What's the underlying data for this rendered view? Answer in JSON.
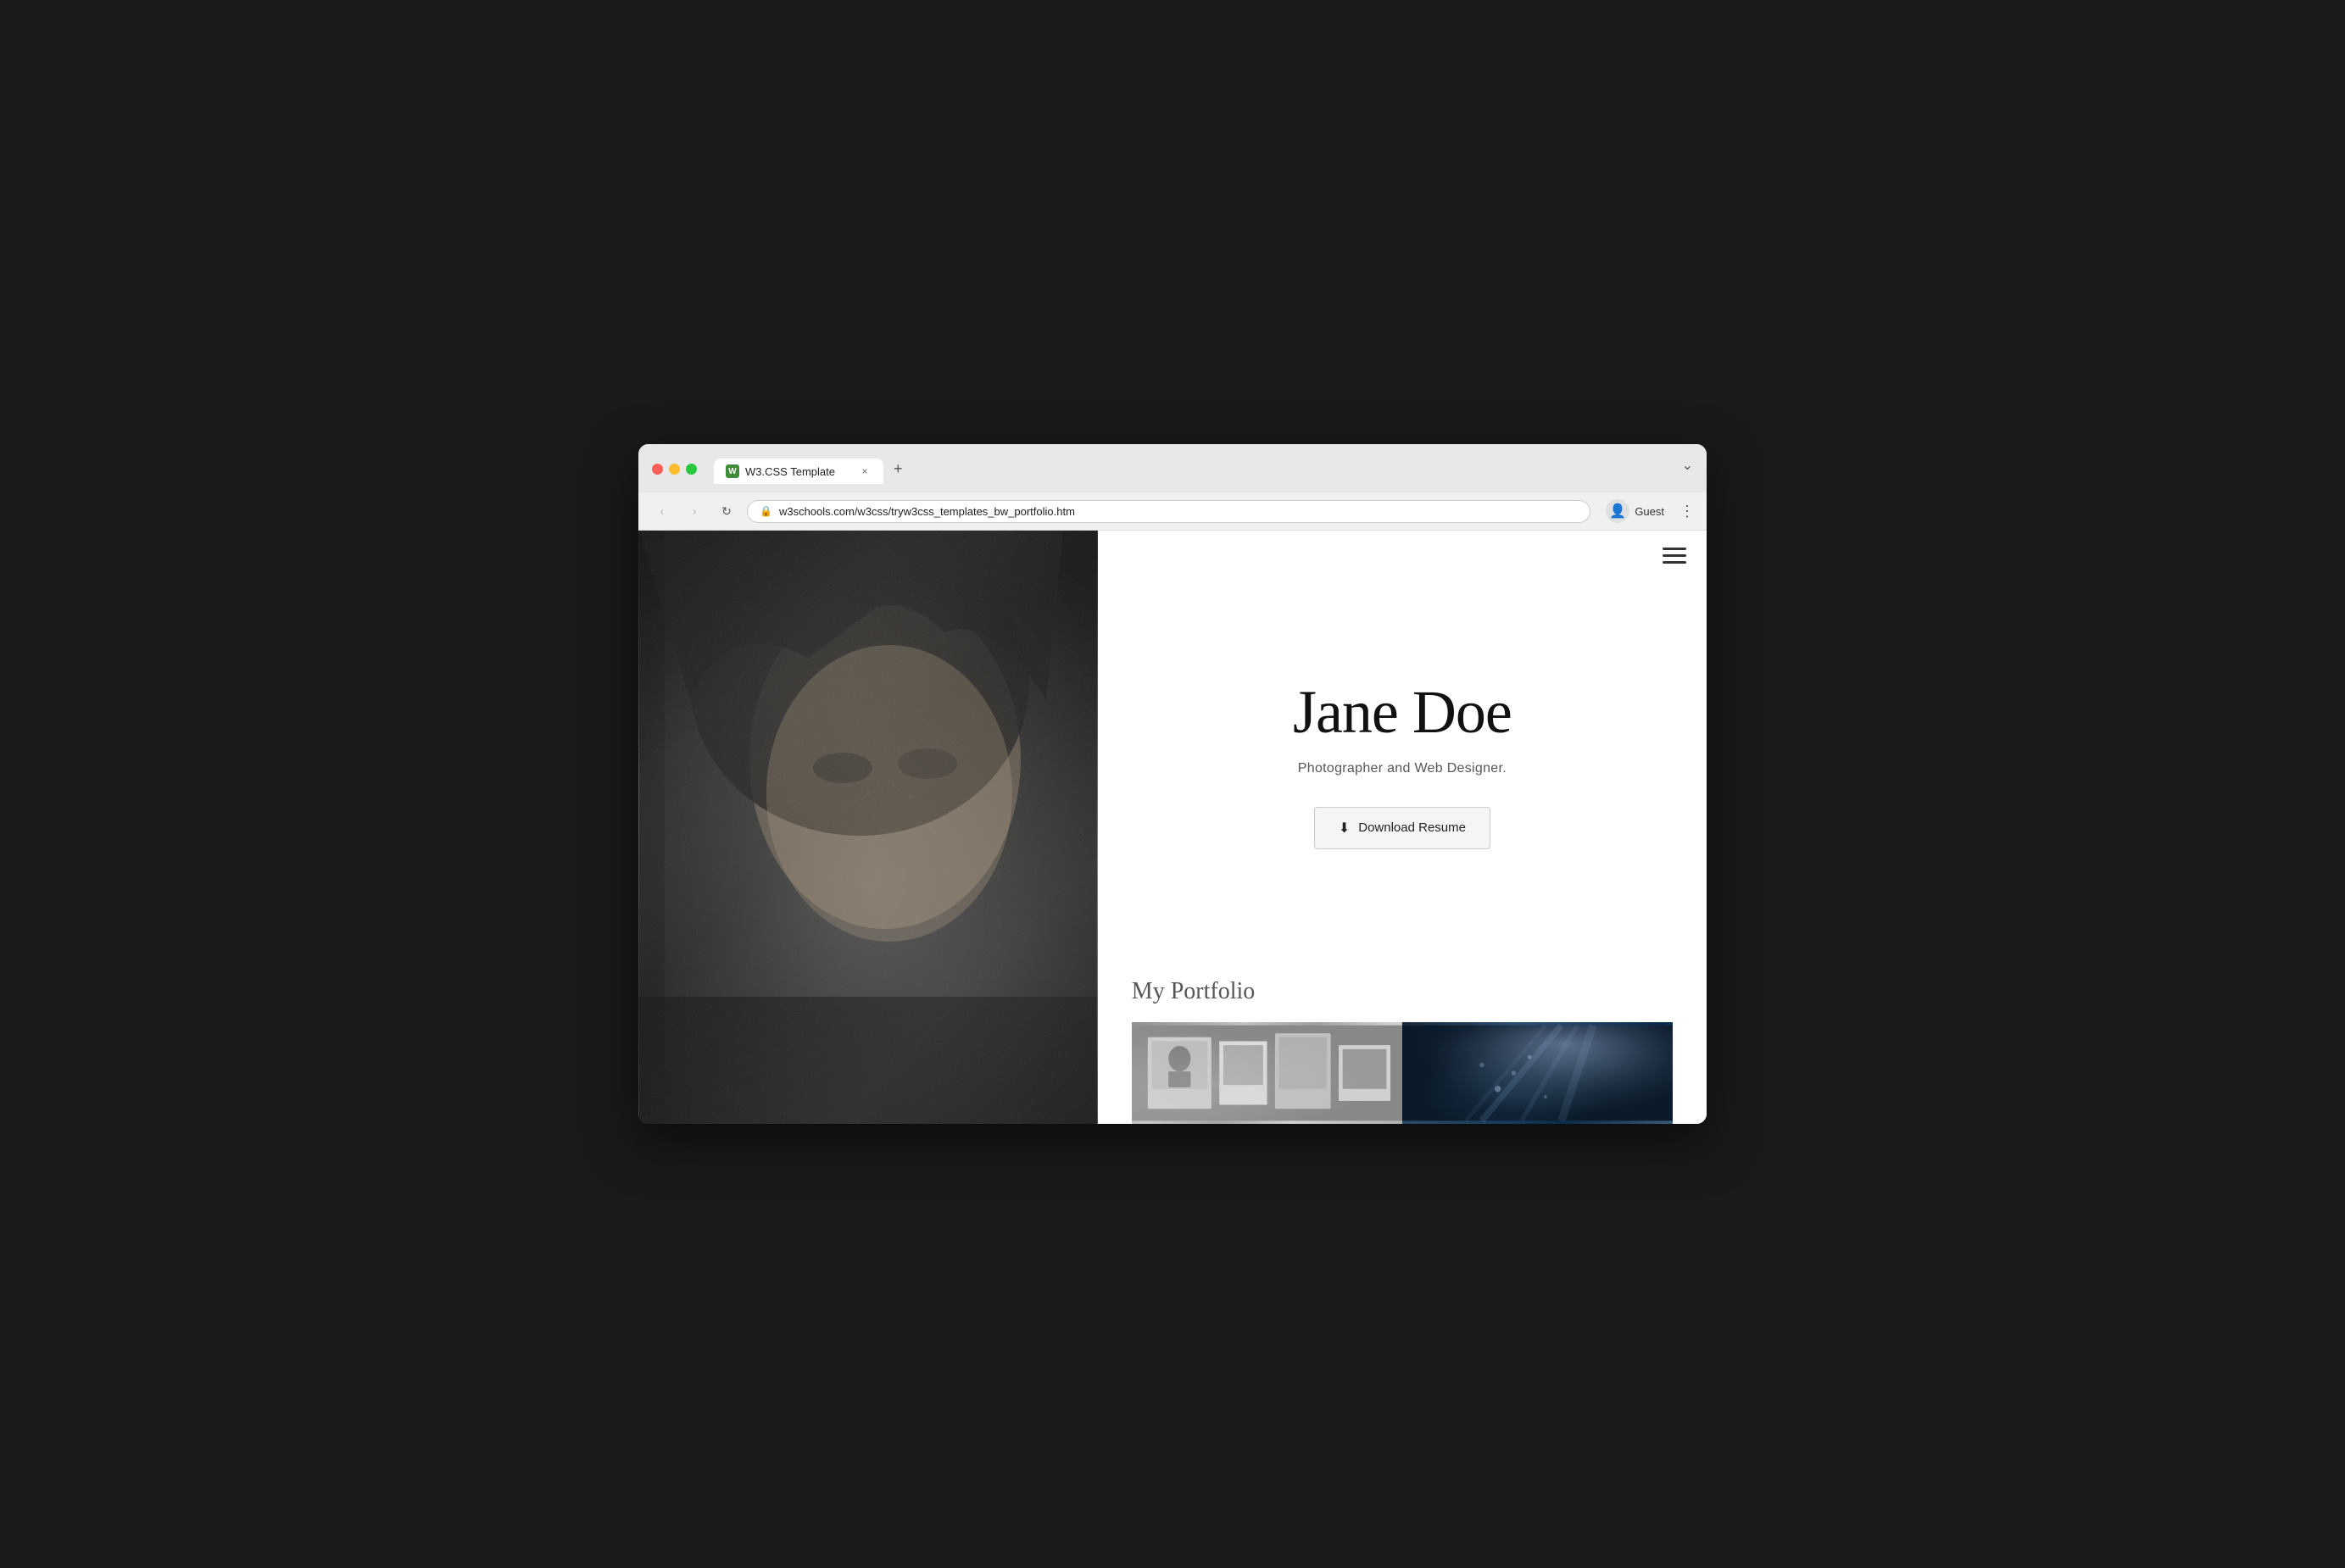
{
  "browser": {
    "tab": {
      "favicon_label": "W",
      "title": "W3.CSS Template",
      "close_icon": "×",
      "new_tab_icon": "+"
    },
    "window_controls": {
      "chevron": "⌄"
    },
    "address_bar": {
      "back_icon": "‹",
      "forward_icon": "›",
      "reload_icon": "↻",
      "lock_icon": "🔒",
      "url": "w3schools.com/w3css/tryw3css_templates_bw_portfolio.htm",
      "profile_icon": "👤",
      "profile_label": "Guest",
      "more_icon": "⋮"
    }
  },
  "site": {
    "hamburger_lines": 3,
    "hero": {
      "name": "Jane Doe",
      "subtitle": "Photographer and Web Designer.",
      "download_button": "Download Resume",
      "download_icon": "⬇"
    },
    "portfolio": {
      "section_title": "My Portfolio"
    }
  }
}
